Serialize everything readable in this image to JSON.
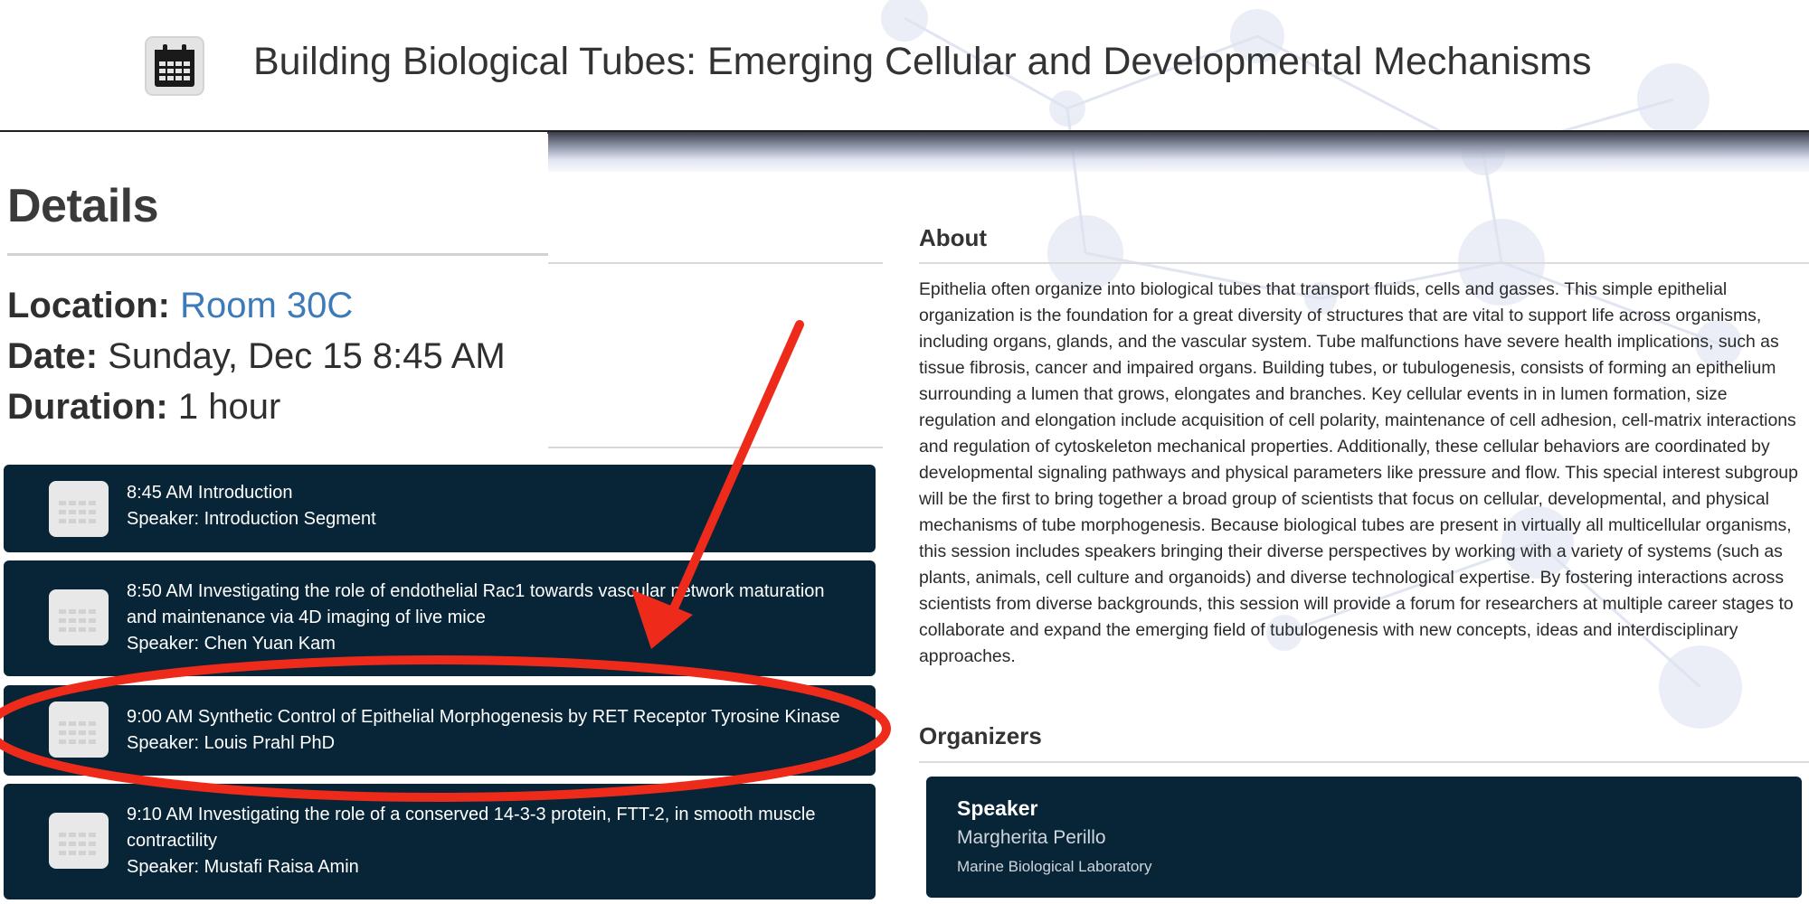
{
  "header": {
    "icon": "calendar-icon",
    "title": "Building Biological Tubes: Emerging Cellular and Developmental Mechanisms"
  },
  "details": {
    "heading": "Details",
    "location_label": "Location:",
    "location_value": "Room 30C",
    "date_label": "Date:",
    "date_value": "Sunday, Dec 15 8:45 AM",
    "duration_label": "Duration:",
    "duration_value": "1 hour"
  },
  "agenda": {
    "items": [
      {
        "title": "8:45 AM Introduction",
        "speaker": "Speaker: Introduction Segment"
      },
      {
        "title": "8:50 AM Investigating the role of endothelial Rac1 towards vascular network maturation and maintenance via 4D imaging of live mice",
        "speaker": "Speaker: Chen Yuan Kam"
      },
      {
        "title": "9:00 AM Synthetic Control of Epithelial Morphogenesis by RET Receptor Tyrosine Kinase",
        "speaker": "Speaker: Louis Prahl PhD"
      },
      {
        "title": "9:10 AM Investigating the role of a conserved 14-3-3 protein, FTT-2, in smooth muscle contractility",
        "speaker": "Speaker: Mustafi Raisa Amin"
      }
    ]
  },
  "about": {
    "heading": "About",
    "body": "Epithelia often organize into biological tubes that transport fluids, cells and gasses. This simple epithelial organization is the foundation for a great diversity of structures that are vital to support life across organisms, including organs, glands, and the vascular system. Tube malfunctions have severe health implications, such as tissue fibrosis, cancer and impaired organs. Building tubes, or tubulogenesis, consists of forming an epithelium surrounding a lumen that grows, elongates and branches. Key cellular events in in lumen formation, size regulation and elongation include acquisition of cell polarity, maintenance of cell adhesion, cell-matrix interactions and regulation of cytoskeleton mechanical properties. Additionally, these cellular behaviors are coordinated by developmental signaling pathways and physical parameters like pressure and flow. This special interest subgroup will be the first to bring together a broad group of scientists that focus on cellular, developmental, and physical mechanisms of tube morphogenesis. Because biological tubes are present in virtually all multicellular organisms, this session includes speakers bringing their diverse perspectives by working with a variety of systems (such as plants, animals, cell culture and organoids) and diverse technological expertise. By fostering interactions across scientists from diverse backgrounds, this session will provide a forum for researchers at multiple career stages to collaborate and expand the emerging field of tubulogenesis with new concepts, ideas and interdisciplinary approaches."
  },
  "organizers": {
    "heading": "Organizers",
    "items": [
      {
        "role": "Speaker",
        "name": "Margherita Perillo",
        "affiliation": "Marine Biological Laboratory"
      }
    ]
  },
  "colors": {
    "card_bg": "#072537",
    "link": "#3d7ab8",
    "annotation": "#ee2b1b"
  },
  "annotation": {
    "highlighted_item": "agenda.items.2",
    "shapes": [
      "red-ellipse",
      "red-arrow"
    ]
  }
}
